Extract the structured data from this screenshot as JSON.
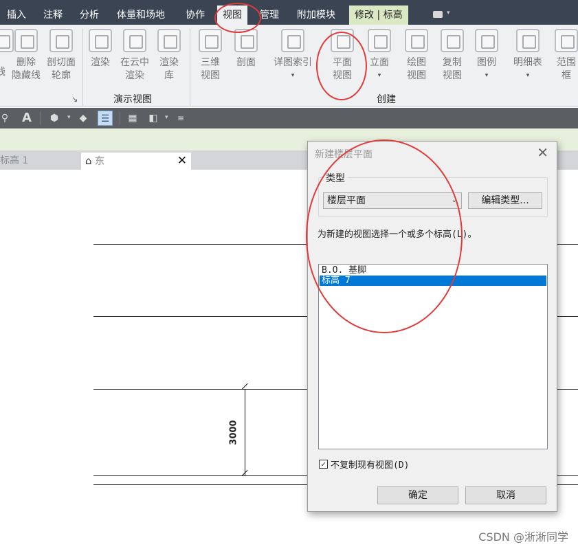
{
  "menu_tabs": [
    "插入",
    "注释",
    "分析",
    "体量和场地",
    "协作",
    "视图",
    "管理",
    "附加模块",
    "修改 | 标高"
  ],
  "active_tab": "视图",
  "ribbon": {
    "buttons": [
      {
        "label": "线",
        "icon": "line-icon"
      },
      {
        "label": "删除\n隐藏线",
        "icon": "remove-hidden-lines-icon"
      },
      {
        "label": "剖切面\n轮廓",
        "icon": "cut-profile-icon"
      },
      {
        "label": "渲染",
        "icon": "render-teapot-icon"
      },
      {
        "label": "在云中\n渲染",
        "icon": "render-cloud-icon"
      },
      {
        "label": "渲染\n库",
        "icon": "render-gallery-icon"
      },
      {
        "label": "三维\n视图",
        "icon": "3d-view-icon",
        "dropdown": true
      },
      {
        "label": "剖面",
        "icon": "section-icon"
      },
      {
        "label": "详图索引",
        "icon": "callout-icon",
        "dropdown": true
      },
      {
        "label": "平面\n视图",
        "icon": "plan-view-icon",
        "dropdown": true
      },
      {
        "label": "立面",
        "icon": "elevation-icon",
        "dropdown": true
      },
      {
        "label": "绘图\n视图",
        "icon": "drafting-view-icon"
      },
      {
        "label": "复制\n视图",
        "icon": "duplicate-view-icon",
        "dropdown": true
      },
      {
        "label": "图例",
        "icon": "legend-icon",
        "dropdown": true
      },
      {
        "label": "明细表",
        "icon": "schedule-icon",
        "dropdown": true
      },
      {
        "label": "范围\n框",
        "icon": "scope-box-icon"
      }
    ],
    "panel_titles": {
      "presentation": "演示视图",
      "create": "创建"
    }
  },
  "view_tabs": {
    "inactive": "标高 1",
    "active": "东"
  },
  "drawing": {
    "dimension_text": "3000"
  },
  "dialog": {
    "title": "新建楼层平面",
    "type_legend": "类型",
    "type_value": "楼层平面",
    "edit_type_label": "编辑类型...",
    "prompt": "为新建的视图选择一个或多个标高(L)。",
    "levels": [
      "B.O. 基脚",
      "标高 7"
    ],
    "selected_level_index": 1,
    "checkbox_label": "不复制现有视图(D)",
    "checkbox_checked": true,
    "ok_label": "确定",
    "cancel_label": "取消"
  },
  "watermark": "CSDN @淅淅同学",
  "colors": {
    "tab_bar": "#3b4452",
    "ribbon_bg": "#eef0f2",
    "selection_blue": "#0078d7",
    "annotation_red": "#e03a3a"
  }
}
